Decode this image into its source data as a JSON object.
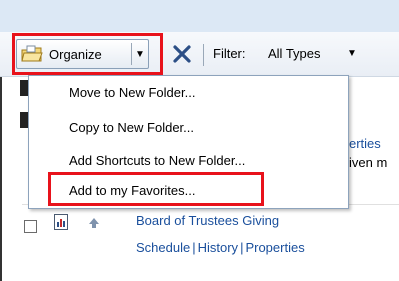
{
  "toolbar": {
    "organize_label": "Organize",
    "filter_label": "Filter:",
    "filter_value": "All Types"
  },
  "organize_menu": {
    "items": [
      {
        "label": "Move to New Folder..."
      },
      {
        "label": "Copy to New Folder..."
      },
      {
        "label": "Add Shortcuts to New Folder..."
      },
      {
        "label": "Add to my Favorites..."
      }
    ]
  },
  "background_list": {
    "partial_link": "erties",
    "partial_text": "iven m"
  },
  "list_row": {
    "title": "Board of Trustees Giving",
    "links": [
      "Schedule",
      "History",
      "Properties"
    ],
    "separator": "|"
  },
  "colors": {
    "highlight": "#e8121b",
    "link": "#1a4f9c"
  },
  "icons": {
    "organize": "folder-organize-icon",
    "close": "close-x-icon",
    "dropdown": "chevron-down-icon",
    "document": "report-document-icon",
    "arrow": "up-arrow-icon"
  }
}
